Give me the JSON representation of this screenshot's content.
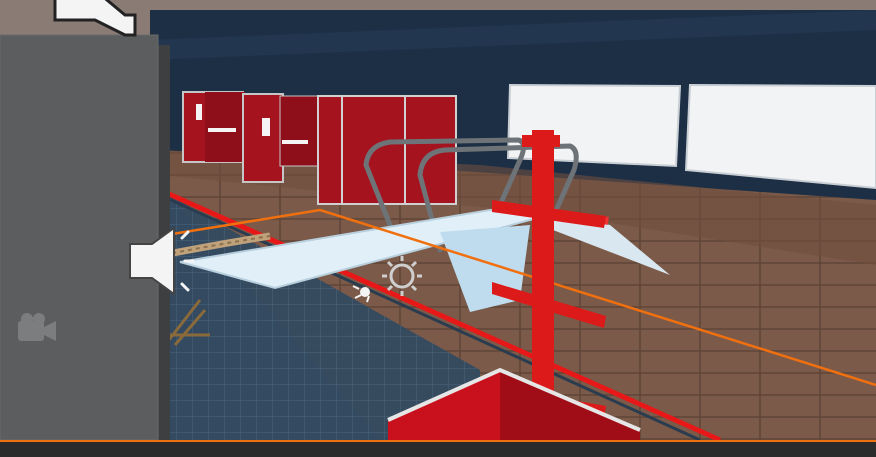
{
  "editor": {
    "view": "scene-view",
    "selection_color": "#f07010",
    "gizmo_icons": [
      "audio-source-icon",
      "audio-source-icon",
      "directional-light-icon",
      "camera-icon",
      "light-icon"
    ]
  },
  "scene": {
    "props": [
      "diving-board",
      "diving-platform-railing",
      "red-locker-booths",
      "red-coat-rack",
      "red-storage-bin",
      "rope",
      "whiteboard",
      "whiteboard"
    ],
    "colors": {
      "wall": "#1c2f45",
      "floor": "#7d5a48",
      "pool": "#263a4d",
      "lockers": "#a5131f",
      "board": "#dcedf8",
      "rack": "#dd1a1a"
    }
  }
}
